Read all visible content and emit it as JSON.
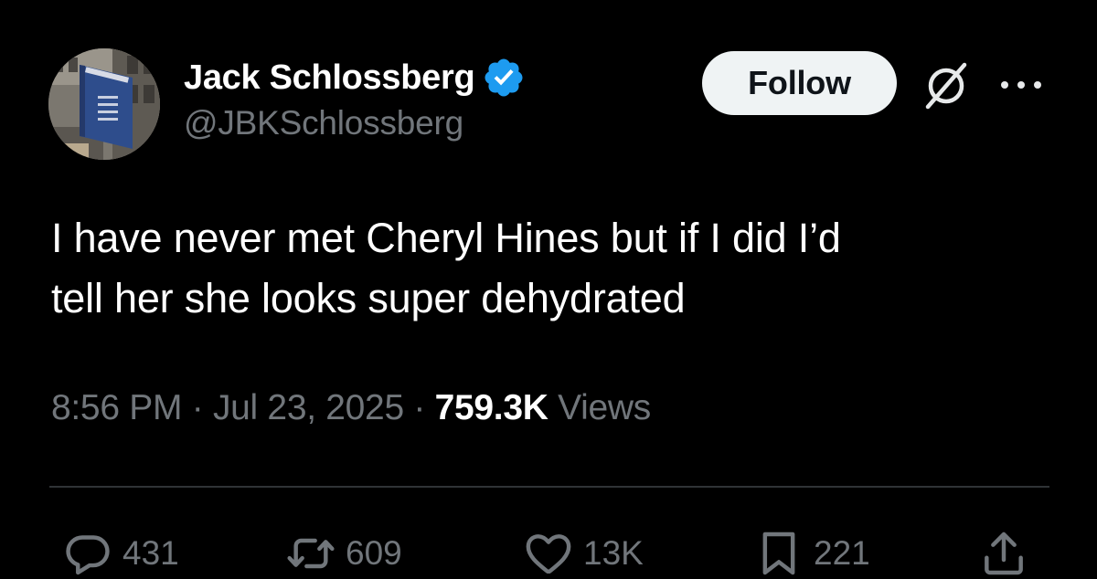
{
  "author": {
    "display_name": "Jack Schlossberg",
    "handle": "@JBKSchlossberg",
    "verified": true,
    "verified_color": "#1d9bf0"
  },
  "header": {
    "follow_label": "Follow",
    "grok_icon": "grok-slash-circle-icon",
    "more_icon": "more-dots-icon"
  },
  "tweet": {
    "line1": "I have never met Cheryl Hines but if I did I’d",
    "line2": "tell her she looks super dehydrated",
    "time": "8:56 PM",
    "date": "Jul 23, 2025",
    "separator": "·",
    "views_count": "759.3K",
    "views_label": "Views"
  },
  "actions": {
    "replies": "431",
    "reposts": "609",
    "likes": "13K",
    "bookmarks": "221"
  },
  "colors": {
    "background": "#000000",
    "text": "#e7e9ea",
    "muted": "#71767b",
    "divider": "#2f3336",
    "follow_bg": "#eff3f4"
  }
}
